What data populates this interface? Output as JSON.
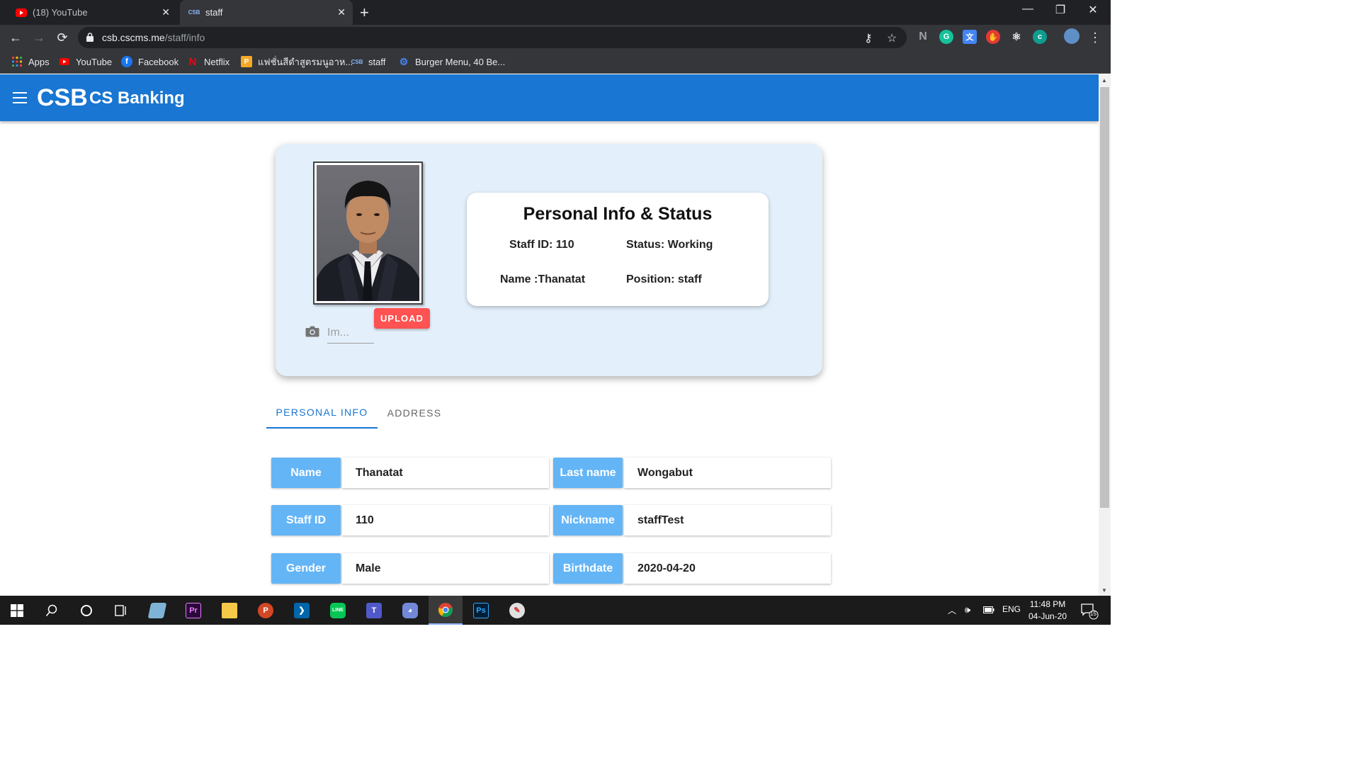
{
  "browser": {
    "tabs": [
      {
        "title": "(18) YouTube",
        "active": false
      },
      {
        "title": "staff",
        "favicon_text": "CSB",
        "active": true
      }
    ],
    "url_host": "csb.cscms.me",
    "url_path": "/staff/info",
    "bookmarks": [
      {
        "label": "Apps"
      },
      {
        "label": "YouTube"
      },
      {
        "label": "Facebook"
      },
      {
        "label": "Netflix"
      },
      {
        "label": "แฟชั่นสีดำสูตรมนูอาห..."
      },
      {
        "label": "staff",
        "icon_text": "CSB"
      },
      {
        "label": "Burger Menu, 40 Be..."
      }
    ]
  },
  "app": {
    "logo": "CSB",
    "title": "CS Banking",
    "accent_color": "#1976d2"
  },
  "profile": {
    "image_input_placeholder": "Im...",
    "upload_label": "UPLOAD",
    "info_title": "Personal Info & Status",
    "staff_id": "Staff ID: 110",
    "status": "Status: Working",
    "name": "Name :Thanatat",
    "position": "Position: staff"
  },
  "tabs": [
    {
      "label": "PERSONAL INFO",
      "active": true
    },
    {
      "label": "ADDRESS",
      "active": false
    }
  ],
  "fields": [
    {
      "label": "Name",
      "value": "Thanatat"
    },
    {
      "label": "Last name",
      "value": "Wongabut"
    },
    {
      "label": "Staff ID",
      "value": "110"
    },
    {
      "label": "Nickname",
      "value": "staffTest"
    },
    {
      "label": "Gender",
      "value": "Male"
    },
    {
      "label": "Birthdate",
      "value": "2020-04-20"
    }
  ],
  "taskbar": {
    "language": "ENG",
    "time": "11:48 PM",
    "date": "04-Jun-20",
    "notification_count": "15"
  }
}
